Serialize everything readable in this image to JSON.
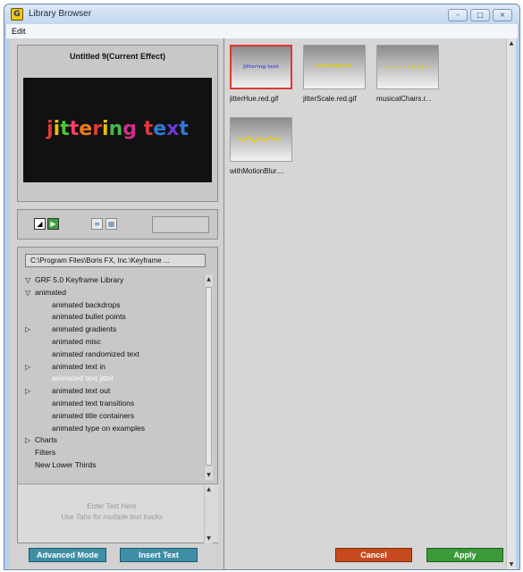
{
  "window": {
    "title": "Library Browser",
    "app_icon": "library-browser-app-icon",
    "minimize_icon": "minimize-icon",
    "maximize_icon": "maximize-icon",
    "close_icon": "close-icon"
  },
  "menu": {
    "edit": "Edit"
  },
  "preview": {
    "title": "Untitled 9(Current Effect)",
    "text_chars": [
      {
        "c": "j",
        "color": "#e03a3a"
      },
      {
        "c": "i",
        "color": "#e8c000"
      },
      {
        "c": "t",
        "color": "#4ec43a"
      },
      {
        "c": "t",
        "color": "#ff3c6a"
      },
      {
        "c": "e",
        "color": "#f07a1a"
      },
      {
        "c": "r",
        "color": "#e03a3a"
      },
      {
        "c": "i",
        "color": "#e8c000"
      },
      {
        "c": "n",
        "color": "#42b84a"
      },
      {
        "c": "g",
        "color": "#d02f8a"
      },
      {
        "c": " ",
        "color": "#ffffff"
      },
      {
        "c": "t",
        "color": "#e03a3a"
      },
      {
        "c": "e",
        "color": "#2e7bd6"
      },
      {
        "c": "x",
        "color": "#6a3ad6"
      },
      {
        "c": "t",
        "color": "#2e7bd6"
      }
    ]
  },
  "path": "C:\\Program Files\\Boris FX, Inc.\\Keyframe ...",
  "tree": [
    {
      "label": "GRF 5.0 Keyframe Library",
      "indent": 0,
      "toggle": "expanded",
      "selected": false
    },
    {
      "label": "animated",
      "indent": 0,
      "toggle": "expanded",
      "selected": false
    },
    {
      "label": "animated backdrops",
      "indent": 1,
      "toggle": "none",
      "selected": false
    },
    {
      "label": "animated bullet points",
      "indent": 1,
      "toggle": "none",
      "selected": false
    },
    {
      "label": "animated gradients",
      "indent": 1,
      "toggle": "collapsed",
      "selected": false
    },
    {
      "label": "animated misc",
      "indent": 1,
      "toggle": "none",
      "selected": false
    },
    {
      "label": "animated randomized text",
      "indent": 1,
      "toggle": "none",
      "selected": false
    },
    {
      "label": "animated text in",
      "indent": 1,
      "toggle": "collapsed",
      "selected": false
    },
    {
      "label": "animated text jitter",
      "indent": 1,
      "toggle": "none",
      "selected": true
    },
    {
      "label": "animated text out",
      "indent": 1,
      "toggle": "collapsed",
      "selected": false
    },
    {
      "label": "animated text transitions",
      "indent": 1,
      "toggle": "none",
      "selected": false
    },
    {
      "label": "animated title containers",
      "indent": 1,
      "toggle": "none",
      "selected": false
    },
    {
      "label": "animated type on examples",
      "indent": 1,
      "toggle": "none",
      "selected": false
    },
    {
      "label": "Charts",
      "indent": 0,
      "toggle": "collapsed",
      "selected": false
    },
    {
      "label": "Filters",
      "indent": 0,
      "toggle": "none",
      "selected": false
    },
    {
      "label": "New Lower Thirds",
      "indent": 0,
      "toggle": "none",
      "selected": false
    }
  ],
  "text_entry": {
    "line1": "Enter Text Here",
    "line2": "Use Tabs for multiple text tracks"
  },
  "buttons": {
    "advanced_mode": "Advanced Mode",
    "insert_text": "Insert Text",
    "cancel": "Cancel",
    "apply": "Apply"
  },
  "thumbnails": [
    {
      "label": "jitterHue.red.gif",
      "preview_text": "jittering text",
      "selected": true
    },
    {
      "label": "jitterScale.red.gif",
      "preview_text": "jittering text",
      "selected": false
    },
    {
      "label": "musicalChairs.r...",
      "preview_text": "",
      "selected": false
    },
    {
      "label": "withMotionBlur....",
      "preview_text": "",
      "selected": false
    }
  ],
  "colors": {
    "selection_outline": "#e0392c",
    "cancel": "#c74a1e",
    "apply": "#3a9a3a",
    "action_blue": "#3e8ea6"
  }
}
